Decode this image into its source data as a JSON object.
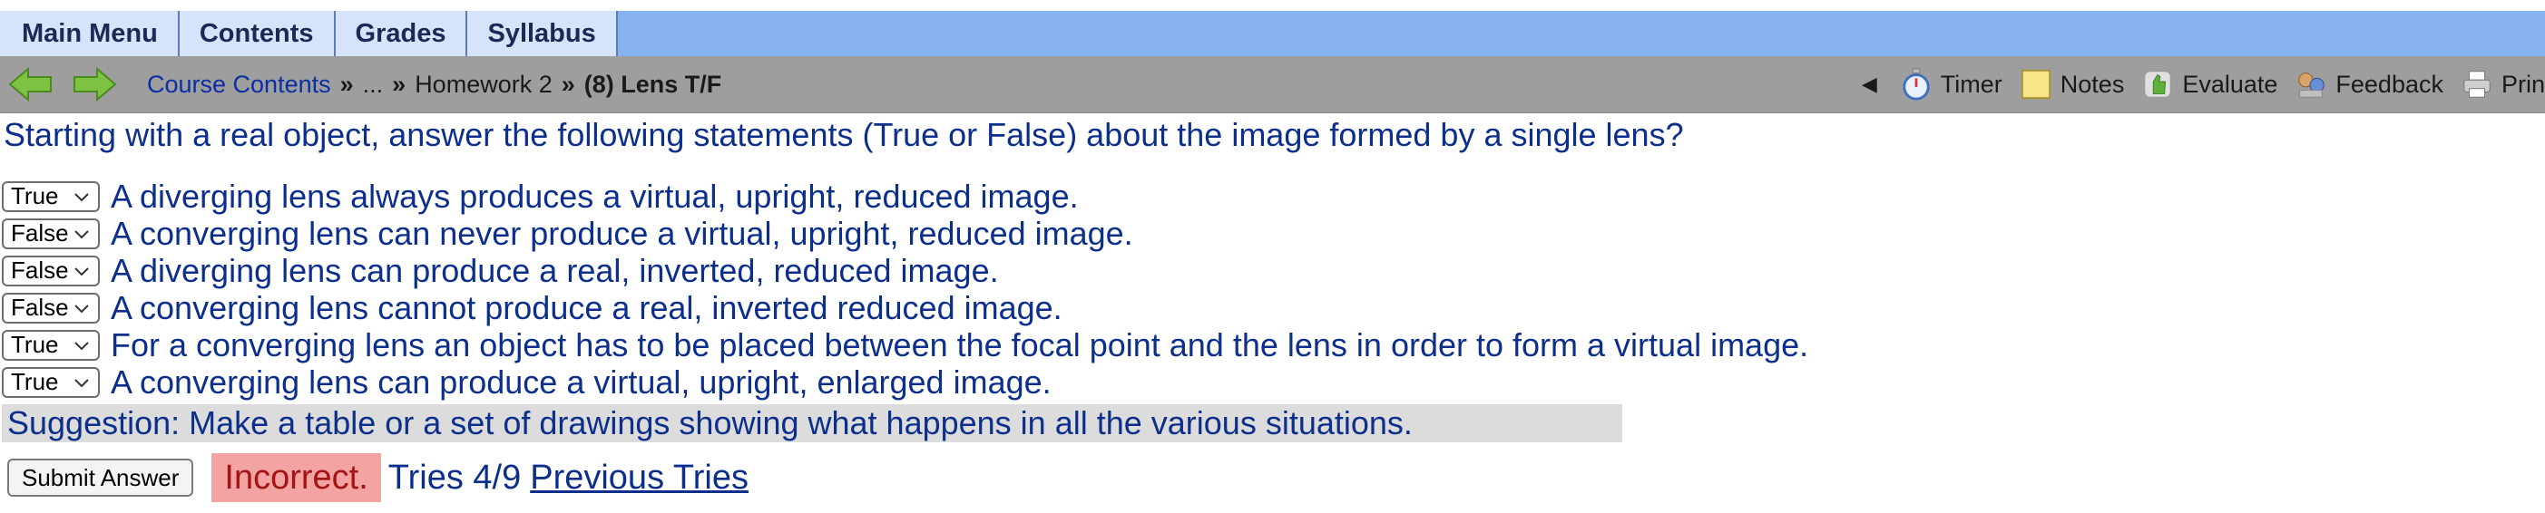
{
  "menu": {
    "tabs": [
      {
        "label": "Main Menu"
      },
      {
        "label": "Contents"
      },
      {
        "label": "Grades"
      },
      {
        "label": "Syllabus"
      }
    ]
  },
  "nav": {
    "breadcrumb": {
      "root": "Course Contents",
      "ellipsis": "...",
      "parent": "Homework 2",
      "current": "(8) Lens T/F",
      "separator": "»"
    },
    "collapse_glyph": "◀",
    "tools": [
      {
        "label": "Timer",
        "icon": "timer-icon"
      },
      {
        "label": "Notes",
        "icon": "notes-icon"
      },
      {
        "label": "Evaluate",
        "icon": "evaluate-icon"
      },
      {
        "label": "Feedback",
        "icon": "feedback-icon"
      },
      {
        "label": "Prin",
        "icon": "print-icon"
      }
    ]
  },
  "problem": {
    "question": "Starting with a real object, answer the following statements (True or False) about the image formed by a single lens?",
    "statements": [
      {
        "answer": "True",
        "text": "A diverging lens always produces a virtual, upright, reduced image."
      },
      {
        "answer": "False",
        "text": "A converging lens can never produce a virtual, upright, reduced image."
      },
      {
        "answer": "False",
        "text": "A diverging lens can produce a real, inverted, reduced image."
      },
      {
        "answer": "False",
        "text": "A converging lens cannot produce a real, inverted reduced image."
      },
      {
        "answer": "True",
        "text": "For a converging lens an object has to be placed between the focal point and the lens in order to form a virtual image."
      },
      {
        "answer": "True",
        "text": "A converging lens can produce a virtual, upright, enlarged image."
      }
    ],
    "suggestion": "Suggestion: Make a table or a set of drawings showing what happens in all the various situations.",
    "submit_label": "Submit Answer",
    "status": "Incorrect.",
    "tries": "Tries 4/9",
    "previous_tries": "Previous Tries"
  },
  "colors": {
    "menu_bg": "#86b3f0",
    "nav_bg": "#9e9e9e",
    "text_blue": "#0d2f8c",
    "incorrect_bg": "#f4a3a3",
    "incorrect_text": "#a51414"
  }
}
